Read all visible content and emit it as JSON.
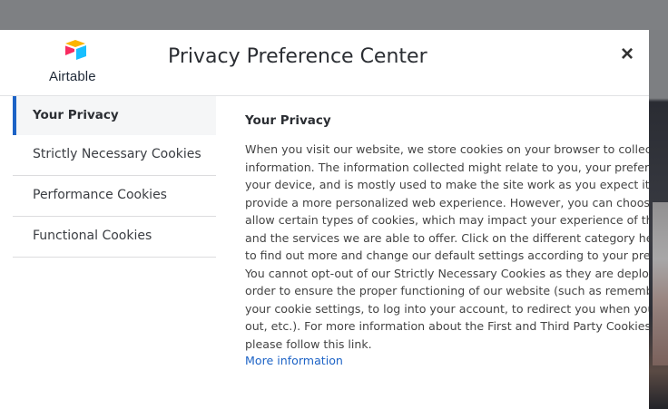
{
  "header": {
    "logo_text": "Airtable",
    "title": "Privacy Preference Center",
    "close_label": "×"
  },
  "tabs": [
    {
      "label": "Your Privacy",
      "active": true
    },
    {
      "label": "Strictly Necessary Cookies",
      "active": false
    },
    {
      "label": "Performance Cookies",
      "active": false
    },
    {
      "label": "Functional Cookies",
      "active": false
    }
  ],
  "content": {
    "heading": "Your Privacy",
    "lines": [
      "When you visit our website, we store cookies on your browser to collect",
      "information. The information collected might relate to you, your preferences or",
      "your device, and is mostly used to make the site work as you expect it to and to",
      "provide a more personalized web experience. However, you can choose not to",
      "allow certain types of cookies, which may impact your experience of the site",
      "and the services we are able to offer. Click on the different category headings",
      "to find out more and change our default settings according to your preference.",
      "You cannot opt-out of our Strictly Necessary Cookies as they are deployed in",
      "order to ensure the proper functioning of our website (such as remembering",
      "your cookie settings, to log into your account, to redirect you when you log",
      "out, etc.). For more information about the First and Third Party Cookies used",
      "please follow this link."
    ],
    "more_link": "More information"
  },
  "colors": {
    "accent": "#1d63c6",
    "backdrop": "#7d7f82"
  }
}
